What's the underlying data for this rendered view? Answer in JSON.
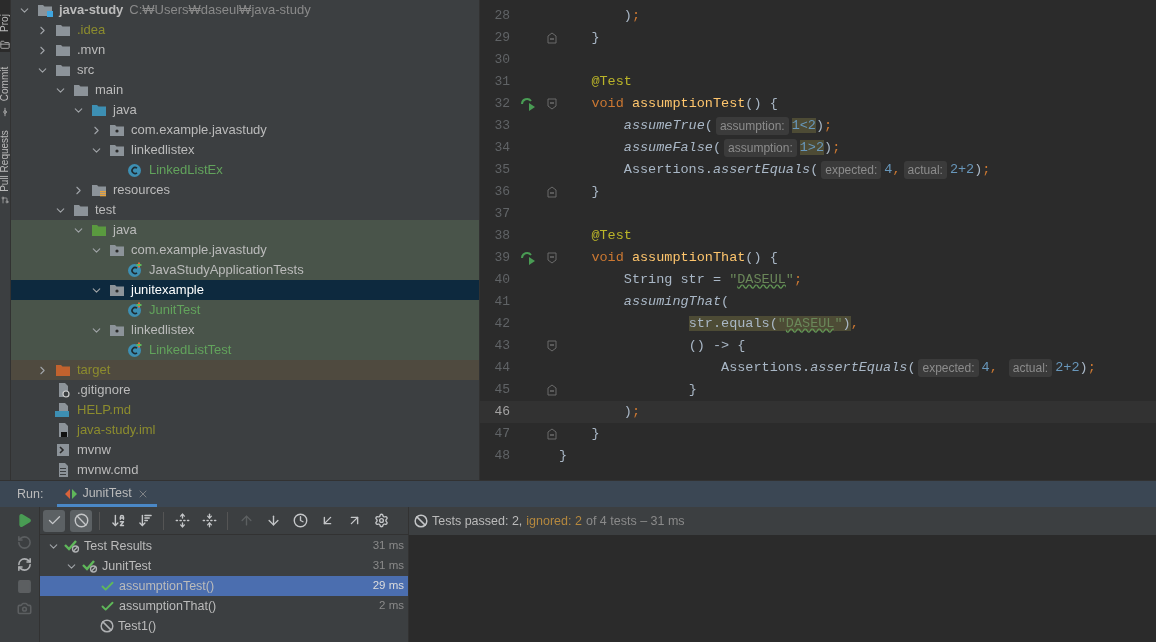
{
  "side_stripe": [
    {
      "label": "Proj",
      "kind": "project",
      "selected": true
    },
    {
      "label": "Commit",
      "kind": "commit",
      "selected": false
    },
    {
      "label": "Pull Requests",
      "kind": "pull-requests",
      "selected": false
    }
  ],
  "project_tree": [
    {
      "name": "java-study",
      "path": "C:₩Users₩daseul₩java-study",
      "kind": "project",
      "color": "#bbbbbb",
      "expanded": true,
      "selected": false,
      "children": [
        {
          "name": ".idea",
          "kind": "folder",
          "color": "#8c8c2e",
          "expanded": false,
          "selected": false
        },
        {
          "name": ".mvn",
          "kind": "folder",
          "color": "#bbbbbb",
          "expanded": false,
          "selected": false
        },
        {
          "name": "src",
          "kind": "folder",
          "color": "#bbbbbb",
          "expanded": true,
          "selected": false,
          "children": [
            {
              "name": "main",
              "kind": "folder",
              "color": "#bbbbbb",
              "expanded": true,
              "selected": false,
              "children": [
                {
                  "name": "java",
                  "kind": "source-folder",
                  "color": "#bbbbbb",
                  "expanded": true,
                  "selected": false,
                  "children": [
                    {
                      "name": "com.example.javastudy",
                      "kind": "package",
                      "color": "#bbbbbb",
                      "expanded": false,
                      "selected": false
                    },
                    {
                      "name": "linkedlistex",
                      "kind": "package",
                      "color": "#bbbbbb",
                      "expanded": true,
                      "selected": false,
                      "children": [
                        {
                          "name": "LinkedListEx",
                          "kind": "class",
                          "color": "#62a35c",
                          "selected": false
                        }
                      ]
                    }
                  ]
                },
                {
                  "name": "resources",
                  "kind": "resources-folder",
                  "color": "#bbbbbb",
                  "expanded": false,
                  "selected": false
                }
              ]
            },
            {
              "name": "test",
              "kind": "folder",
              "color": "#bbbbbb",
              "expanded": true,
              "selected": false,
              "children": [
                {
                  "name": "java",
                  "kind": "test-folder",
                  "color": "#bbbbbb",
                  "expanded": true,
                  "selected": false,
                  "test_sources": true,
                  "children": [
                    {
                      "name": "com.example.javastudy",
                      "kind": "package",
                      "color": "#bbbbbb",
                      "expanded": true,
                      "selected": false,
                      "test_sources": true,
                      "children": [
                        {
                          "name": "JavaStudyApplicationTests",
                          "kind": "test-class",
                          "color": "#bbbbbb",
                          "selected": false,
                          "test_sources": true
                        }
                      ]
                    },
                    {
                      "name": "junitexample",
                      "kind": "package",
                      "expanded": true,
                      "selected": true,
                      "test_sources": true,
                      "children": [
                        {
                          "name": "JunitTest",
                          "kind": "test-class",
                          "color": "#62a35c",
                          "selected": false,
                          "test_sources": true
                        }
                      ]
                    },
                    {
                      "name": "linkedlistex",
                      "kind": "package",
                      "color": "#bbbbbb",
                      "expanded": true,
                      "selected": false,
                      "test_sources": true,
                      "children": [
                        {
                          "name": "LinkedListTest",
                          "kind": "test-class",
                          "color": "#62a35c",
                          "selected": false,
                          "test_sources": true
                        }
                      ]
                    }
                  ]
                }
              ]
            }
          ]
        },
        {
          "name": "target",
          "kind": "excluded-folder",
          "color": "#8c8c2e",
          "expanded": false,
          "selected": false,
          "excluded": true
        },
        {
          "name": ".gitignore",
          "kind": "ignore-file",
          "color": "#bbbbbb",
          "selected": false
        },
        {
          "name": "HELP.md",
          "kind": "markdown-file",
          "color": "#8c8c2e",
          "selected": false
        },
        {
          "name": "java-study.iml",
          "kind": "module-file",
          "color": "#8c8c2e",
          "selected": false
        },
        {
          "name": "mvnw",
          "kind": "shell-file",
          "color": "#bbbbbb",
          "selected": false
        },
        {
          "name": "mvnw.cmd",
          "kind": "text-file",
          "color": "#bbbbbb",
          "selected": false
        }
      ]
    }
  ],
  "editor": {
    "lines": [
      {
        "number": "28",
        "current": false,
        "tokens": [
          {
            "text": "        )",
            "kind": "plain"
          },
          {
            "text": ";",
            "kind": "punct"
          }
        ]
      },
      {
        "number": "29",
        "current": false,
        "fold_end": true,
        "tokens": [
          {
            "text": "    }",
            "kind": "plain"
          }
        ]
      },
      {
        "number": "30",
        "current": false
      },
      {
        "number": "31",
        "current": false,
        "tokens": [
          {
            "text": "    @Test",
            "kind": "annotation"
          }
        ]
      },
      {
        "number": "32",
        "current": false,
        "run": true,
        "fold_start": true,
        "tokens": [
          {
            "text": "    void",
            "kind": "keyword"
          },
          {
            "text": " assumptionTest",
            "kind": "declaration"
          },
          {
            "text": "() {",
            "kind": "plain"
          }
        ]
      },
      {
        "number": "33",
        "current": false,
        "tokens": [
          {
            "text": "        assumeTrue",
            "kind": "static-call"
          },
          {
            "text": "(",
            "kind": "plain"
          },
          {
            "text": "assumption:",
            "kind": "hint"
          },
          {
            "text": "1<2",
            "kind": "hl-number"
          },
          {
            "text": ")",
            "kind": "plain"
          },
          {
            "text": ";",
            "kind": "punct"
          }
        ]
      },
      {
        "number": "34",
        "current": false,
        "tokens": [
          {
            "text": "        assumeFalse",
            "kind": "static-call"
          },
          {
            "text": "(",
            "kind": "plain"
          },
          {
            "text": "assumption:",
            "kind": "hint"
          },
          {
            "text": "1>2",
            "kind": "hl-number"
          },
          {
            "text": ")",
            "kind": "plain"
          },
          {
            "text": ";",
            "kind": "punct"
          }
        ]
      },
      {
        "number": "35",
        "current": false,
        "tokens": [
          {
            "text": "        Assertions.",
            "kind": "plain"
          },
          {
            "text": "assertEquals",
            "kind": "static-call"
          },
          {
            "text": "(",
            "kind": "plain"
          },
          {
            "text": "expected:",
            "kind": "hint"
          },
          {
            "text": "4",
            "kind": "number"
          },
          {
            "text": ",",
            "kind": "punct"
          },
          {
            "text": "actual:",
            "kind": "hint"
          },
          {
            "text": "2+2",
            "kind": "number"
          },
          {
            "text": ")",
            "kind": "plain"
          },
          {
            "text": ";",
            "kind": "punct"
          }
        ]
      },
      {
        "number": "36",
        "current": false,
        "fold_end": true,
        "tokens": [
          {
            "text": "    }",
            "kind": "plain"
          }
        ]
      },
      {
        "number": "37",
        "current": false
      },
      {
        "number": "38",
        "current": false,
        "tokens": [
          {
            "text": "    @Test",
            "kind": "annotation"
          }
        ]
      },
      {
        "number": "39",
        "current": false,
        "run": true,
        "fold_start": true,
        "tokens": [
          {
            "text": "    void",
            "kind": "keyword"
          },
          {
            "text": " assumptionThat",
            "kind": "declaration"
          },
          {
            "text": "() {",
            "kind": "plain"
          }
        ]
      },
      {
        "number": "40",
        "current": false,
        "tokens": [
          {
            "text": "        String str = ",
            "kind": "plain"
          },
          {
            "text": "\"",
            "kind": "string"
          },
          {
            "text": "DASEUL",
            "kind": "string-typo"
          },
          {
            "text": "\"",
            "kind": "string"
          },
          {
            "text": ";",
            "kind": "punct"
          }
        ]
      },
      {
        "number": "41",
        "current": false,
        "tokens": [
          {
            "text": "        assumingThat",
            "kind": "static-call"
          },
          {
            "text": "(",
            "kind": "plain"
          }
        ]
      },
      {
        "number": "42",
        "current": false,
        "tokens": [
          {
            "text": "                str.equals(",
            "kind": "hl-plain"
          },
          {
            "text": "\"",
            "kind": "hl-string"
          },
          {
            "text": "DASEUL",
            "kind": "hl-string-typo"
          },
          {
            "text": "\"",
            "kind": "hl-string"
          },
          {
            "text": ")",
            "kind": "hl-plain"
          },
          {
            "text": ",",
            "kind": "punct"
          }
        ]
      },
      {
        "number": "43",
        "current": false,
        "fold_start": true,
        "tokens": [
          {
            "text": "                () -> {",
            "kind": "plain"
          }
        ]
      },
      {
        "number": "44",
        "current": false,
        "tokens": [
          {
            "text": "                    Assertions.",
            "kind": "plain"
          },
          {
            "text": "assertEquals",
            "kind": "static-call"
          },
          {
            "text": "(",
            "kind": "plain"
          },
          {
            "text": "expected:",
            "kind": "hint"
          },
          {
            "text": "4",
            "kind": "number"
          },
          {
            "text": ", ",
            "kind": "punct"
          },
          {
            "text": "actual:",
            "kind": "hint"
          },
          {
            "text": "2+2",
            "kind": "number"
          },
          {
            "text": ")",
            "kind": "plain"
          },
          {
            "text": ";",
            "kind": "punct"
          }
        ]
      },
      {
        "number": "45",
        "current": false,
        "fold_end": true,
        "tokens": [
          {
            "text": "                }",
            "kind": "plain"
          }
        ]
      },
      {
        "number": "46",
        "current": true,
        "tokens": [
          {
            "text": "        )",
            "kind": "plain"
          },
          {
            "text": ";",
            "kind": "punct"
          }
        ]
      },
      {
        "number": "47",
        "current": false,
        "fold_end": true,
        "tokens": [
          {
            "text": "    }",
            "kind": "plain"
          }
        ]
      },
      {
        "number": "48",
        "current": false,
        "tokens": [
          {
            "text": "}",
            "kind": "plain"
          }
        ]
      }
    ]
  },
  "run_panel": {
    "label": "Run:",
    "tabs": [
      {
        "label": "JunitTest",
        "selected": true
      }
    ],
    "side_toolbar": [
      {
        "kind": "run",
        "disabled": false
      },
      {
        "kind": "rerun-failed",
        "disabled": true
      },
      {
        "kind": "toggle-auto-test",
        "disabled": false
      },
      {
        "kind": "stop",
        "disabled": true
      },
      {
        "kind": "snapshot",
        "disabled": true
      }
    ],
    "toolbar": [
      {
        "kind": "show-passed",
        "selected": true,
        "disabled": false
      },
      {
        "kind": "show-ignored",
        "selected": true,
        "disabled": false
      },
      {
        "kind": "separator"
      },
      {
        "kind": "sort-alpha",
        "selected": false,
        "disabled": false
      },
      {
        "kind": "sort-duration",
        "selected": false,
        "disabled": false
      },
      {
        "kind": "separator"
      },
      {
        "kind": "expand-all",
        "selected": false,
        "disabled": false
      },
      {
        "kind": "collapse-all",
        "selected": false,
        "disabled": false
      },
      {
        "kind": "separator"
      },
      {
        "kind": "previous",
        "selected": false,
        "disabled": true
      },
      {
        "kind": "next",
        "selected": false,
        "disabled": false
      },
      {
        "kind": "history",
        "selected": false,
        "disabled": false
      },
      {
        "kind": "import",
        "selected": false,
        "disabled": false
      },
      {
        "kind": "export",
        "selected": false,
        "disabled": false
      },
      {
        "kind": "settings",
        "selected": false,
        "disabled": false
      }
    ],
    "status": {
      "passed": "Tests passed: 2,",
      "ignored": "ignored: 2",
      "rest": "of 4 tests – 31 ms"
    },
    "results": [
      {
        "name": "Test Results",
        "time": "31 ms",
        "kind": "passed-ignored",
        "expanded": true,
        "selected": false,
        "children": [
          {
            "name": "JunitTest",
            "time": "31 ms",
            "kind": "passed-ignored",
            "expanded": true,
            "selected": false,
            "children": [
              {
                "name": "assumptionTest()",
                "time": "29 ms",
                "kind": "passed",
                "selected": true
              },
              {
                "name": "assumptionThat()",
                "time": "2 ms",
                "kind": "passed",
                "selected": false
              },
              {
                "name": "Test1()",
                "kind": "ignored",
                "selected": false
              }
            ]
          }
        ]
      }
    ]
  }
}
